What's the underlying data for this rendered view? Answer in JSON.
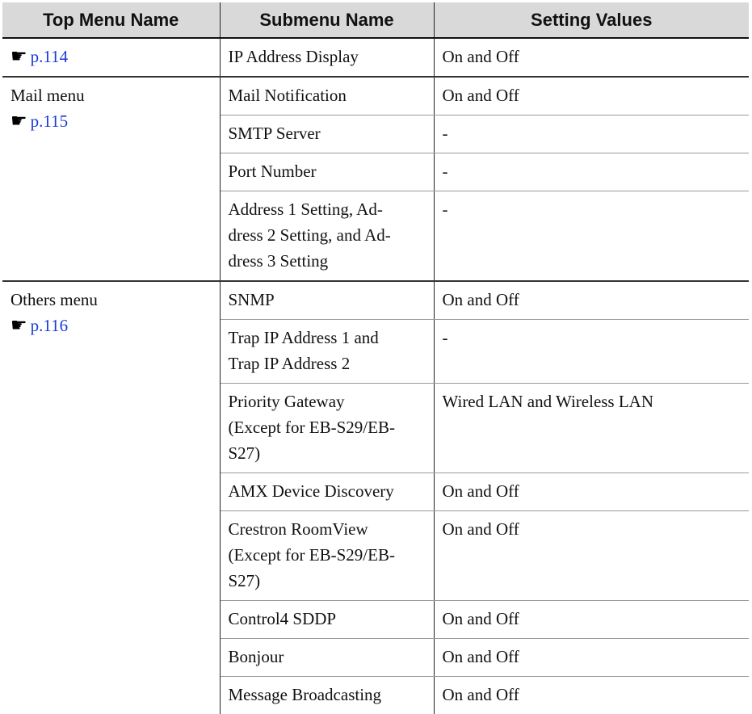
{
  "headers": {
    "top_menu": "Top Menu Name",
    "submenu": "Submenu Name",
    "values": "Setting Values"
  },
  "ref_icon": "pointing-hand-icon",
  "link_color": "#1a3bd6",
  "groups": {
    "network": {
      "ref": "p.114",
      "rows": [
        {
          "sub": [
            "IP Address Display"
          ],
          "val": "On and Off"
        }
      ]
    },
    "mail": {
      "name": "Mail menu",
      "ref": "p.115",
      "rows": [
        {
          "sub": [
            "Mail Notification"
          ],
          "val": "On and Off"
        },
        {
          "sub": [
            "SMTP Server"
          ],
          "val": "-"
        },
        {
          "sub": [
            "Port Number"
          ],
          "val": "-"
        },
        {
          "sub": [
            "Address 1 Setting, Ad-",
            "dress 2 Setting, and Ad-",
            "dress 3 Setting"
          ],
          "val": "-"
        }
      ]
    },
    "others": {
      "name": "Others menu",
      "ref": "p.116",
      "rows": [
        {
          "sub": [
            "SNMP"
          ],
          "val": "On and Off"
        },
        {
          "sub": [
            "Trap IP Address 1 and",
            "Trap IP Address 2"
          ],
          "val": "-"
        },
        {
          "sub": [
            "Priority Gateway",
            "(Except for EB-S29/EB-",
            "S27)"
          ],
          "val": "Wired LAN and Wireless LAN"
        },
        {
          "sub": [
            "AMX Device Discovery"
          ],
          "val": "On and Off"
        },
        {
          "sub": [
            "Crestron RoomView",
            "(Except for EB-S29/EB-",
            "S27)"
          ],
          "val": "On and Off"
        },
        {
          "sub": [
            "Control4 SDDP"
          ],
          "val": "On and Off"
        },
        {
          "sub": [
            "Bonjour"
          ],
          "val": "On and Off"
        },
        {
          "sub": [
            "Message Broadcasting"
          ],
          "val": "On and Off"
        }
      ]
    }
  }
}
